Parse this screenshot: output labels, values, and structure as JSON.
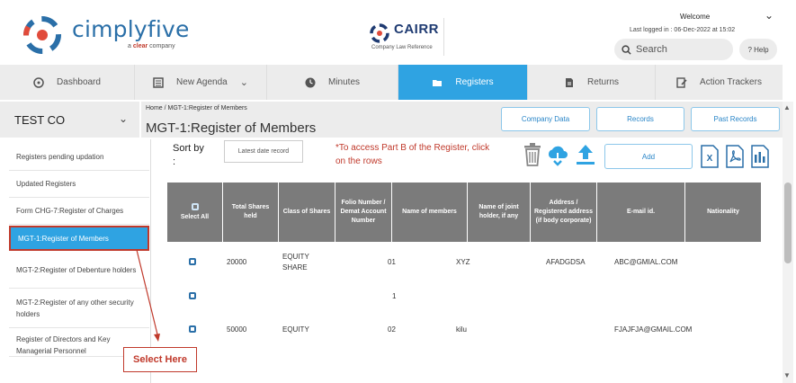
{
  "header": {
    "brand": "cimplyfive",
    "brand_sub_prefix": "a",
    "brand_sub_company": "clear",
    "brand_sub_suffix": "company",
    "cairr": "CAIRR",
    "cairr_sub": "Company Law Reference",
    "welcome": "Welcome",
    "last_login": "Last logged in : 06-Dec-2022 at 15:02",
    "search_label": "Search",
    "help_label": "? Help"
  },
  "nav": [
    {
      "label": "Dashboard",
      "icon": "dashboard-icon"
    },
    {
      "label": "New Agenda",
      "icon": "agenda-icon"
    },
    {
      "label": "Minutes",
      "icon": "clock-icon"
    },
    {
      "label": "Registers",
      "icon": "folder-icon"
    },
    {
      "label": "Returns",
      "icon": "document-icon"
    },
    {
      "label": "Action Trackers",
      "icon": "tracker-icon"
    }
  ],
  "company": "TEST CO",
  "breadcrumb": "Home  /  MGT-1:Register of Members",
  "page_title": "MGT-1:Register of Members",
  "top_buttons": [
    "Company Data",
    "Records",
    "Past Records"
  ],
  "sidebar": [
    "Registers pending updation",
    "Updated Registers",
    "Form CHG-7:Register of Charges",
    "MGT-1:Register of Members",
    "MGT-2:Register of Debenture holders",
    "MGT-2:Register of any other security holders",
    "Register of Directors and Key Managerial Personnel"
  ],
  "sort": {
    "label": "Sort by :",
    "value": "Latest date record"
  },
  "note": "*To access Part B of the Register, click on the rows",
  "add_label": "Add",
  "columns": [
    "Select All",
    "Total Shares held",
    "Class of Shares",
    "Folio Number / Demat Account Number",
    "Name of members",
    "Name of joint holder, if any",
    "Address / Registered address (if body corporate)",
    "E-mail id.",
    "Nationality"
  ],
  "rows": [
    {
      "shares": "20000",
      "class": "EQUITY SHARE",
      "folio": "01",
      "name": "XYZ",
      "joint": "",
      "address": "AFADGDSA",
      "email": "ABC@GMIAL.COM",
      "nationality": ""
    },
    {
      "shares": "",
      "class": "",
      "folio": "1",
      "name": "",
      "joint": "",
      "address": "",
      "email": "",
      "nationality": ""
    },
    {
      "shares": "50000",
      "class": "EQUITY",
      "folio": "02",
      "name": "kilu",
      "joint": "",
      "address": "",
      "email": "FJAJFJA@GMAIL.COM",
      "nationality": ""
    }
  ],
  "annotation": "Select Here",
  "colors": {
    "accent": "#2fa3e2",
    "brand": "#2a6fa8",
    "note_red": "#c0392b",
    "table_header": "#7b7b7b"
  }
}
